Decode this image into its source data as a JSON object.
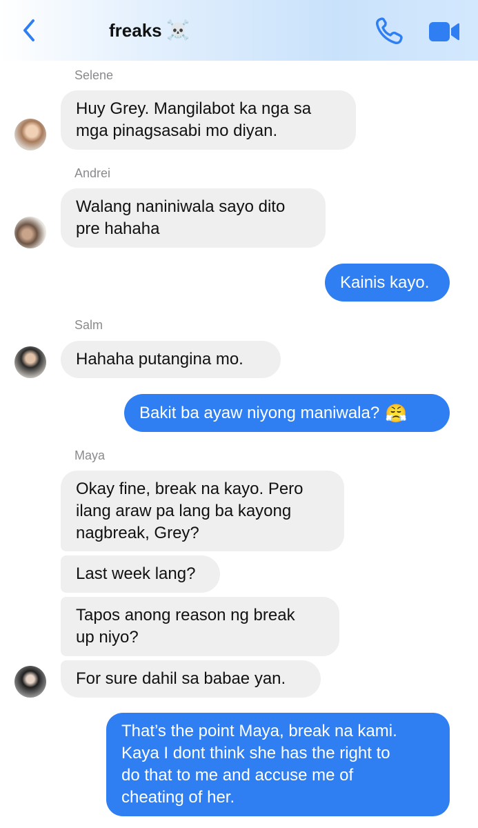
{
  "header": {
    "title": "freaks",
    "title_emoji": "☠️",
    "back_icon": "chevron-left-icon",
    "call_icon": "phone-icon",
    "video_icon": "video-camera-icon",
    "accent_color": "#2f7ff2"
  },
  "messages": {
    "m1": {
      "sender": "Selene",
      "text": "Huy Grey. Mangilabot ka nga sa\nmga pinagsasabi mo diyan."
    },
    "m2": {
      "sender": "Andrei",
      "text": "Walang naniniwala sayo dito\npre hahaha"
    },
    "m3": {
      "text": "Kainis kayo."
    },
    "m4": {
      "sender": "Salm",
      "text": "Hahaha putangina mo."
    },
    "m5": {
      "text": "Bakit ba ayaw niyong maniwala?",
      "emoji": "😤"
    },
    "m6": {
      "sender": "Maya",
      "text": "Okay fine, break na kayo. Pero\nilang araw pa lang ba kayong\nnagbreak, Grey?"
    },
    "m7": {
      "text": "Last week lang?"
    },
    "m8": {
      "text": "Tapos anong reason ng break\nup niyo?"
    },
    "m9": {
      "text": "For sure dahil sa babae yan."
    },
    "m10": {
      "text": "That’s the point Maya, break na kami.\nKaya I dont think she has the right to\ndo that to me and accuse me of\ncheating of her."
    }
  },
  "colors": {
    "incoming_bubble": "#efefef",
    "outgoing_bubble": "#2f7ff2"
  }
}
